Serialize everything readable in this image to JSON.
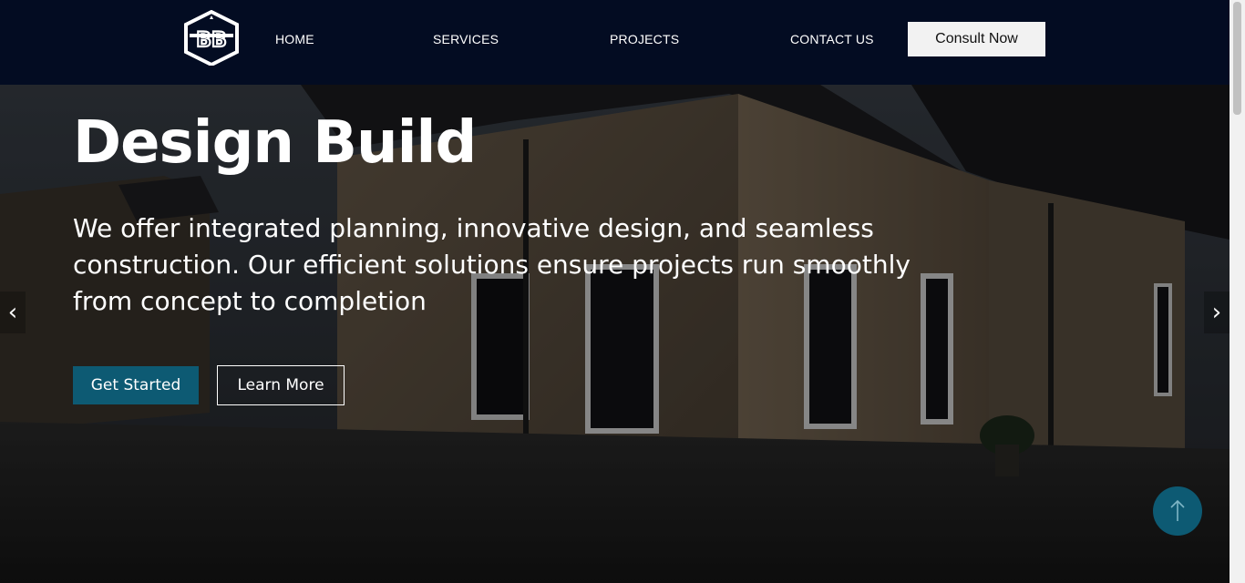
{
  "nav": {
    "logo_text": "BB",
    "links": [
      "HOME",
      "SERVICES",
      "PROJECTS",
      "CONTACT US"
    ],
    "cta": "Consult Now"
  },
  "hero": {
    "title": "Design Build",
    "subtitle": "We offer integrated planning, innovative design, and seamless construction. Our efficient solutions ensure projects run smoothly from concept to completion",
    "primary_button": "Get Started",
    "secondary_button": "Learn More",
    "prev_arrow": "‹",
    "next_arrow": "›"
  },
  "icons": {
    "logo": "hexagon-bb-logo-icon",
    "back_to_top": "arrow-up-icon"
  },
  "colors": {
    "navbar": "#030c22",
    "accent": "#0d5a73"
  }
}
